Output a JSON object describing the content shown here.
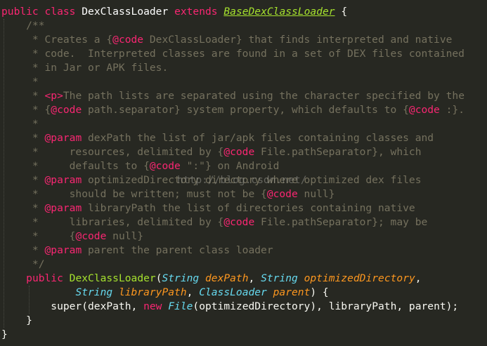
{
  "code": {
    "l1": [
      "public",
      " ",
      "class",
      " ",
      "DexClassLoader",
      " ",
      "extends",
      " ",
      "BaseDexClassLoader",
      " {"
    ],
    "l2": "    /**",
    "l3": [
      "     * Creates a {",
      "@code",
      " DexClassLoader} that finds interpreted and native"
    ],
    "l4": "     * code.  Interpreted classes are found in a set of DEX files contained",
    "l5": "     * in Jar or APK files.",
    "l6": "     *",
    "l7": [
      "     * ",
      "<p>",
      "The path lists are separated using the character specified by the"
    ],
    "l8": [
      "     * {",
      "@code",
      " path.separator} system property, which defaults to {",
      "@code",
      " :}."
    ],
    "l9": "     *",
    "l10": [
      "     * ",
      "@param",
      " dexPath the list of jar/apk files containing classes and"
    ],
    "l11": [
      "     *     resources, delimited by {",
      "@code",
      " File.pathSeparator}, which"
    ],
    "l12": [
      "     *     defaults to {",
      "@code",
      " \":\"} on Android"
    ],
    "l13": [
      "     * ",
      "@param",
      " optimizedDirectory directory where optimized dex files"
    ],
    "l14": [
      "     *     should be written; must not be {",
      "@code",
      " null}"
    ],
    "l15": [
      "     * ",
      "@param",
      " libraryPath the list of directories containing native"
    ],
    "l16": [
      "     *     libraries, delimited by {",
      "@code",
      " File.pathSeparator}; may be"
    ],
    "l17": [
      "     *     {",
      "@code",
      " null}"
    ],
    "l18": [
      "     * ",
      "@param",
      " parent the parent class loader"
    ],
    "l19": "     */",
    "l20": [
      "    ",
      "public",
      " ",
      "DexClassLoader",
      "(",
      "String",
      " ",
      "dexPath",
      ", ",
      "String",
      " ",
      "optimizedDirectory",
      ","
    ],
    "l21": [
      "            ",
      "String",
      " ",
      "libraryPath",
      ", ",
      "ClassLoader",
      " ",
      "parent",
      ") {"
    ],
    "l22": [
      "        super(dexPath, ",
      "new",
      " ",
      "File",
      "(optimizedDirectory), libraryPath, parent);"
    ],
    "l23": "    }",
    "l24": "}"
  },
  "watermark": "http://blog.csdn.net/",
  "colors": {
    "background": "#272822",
    "keyword": "#f92672",
    "function": "#a6e22e",
    "type": "#66d9ef",
    "parameter": "#fd971f",
    "comment": "#75715e",
    "text": "#f8f8f2"
  }
}
